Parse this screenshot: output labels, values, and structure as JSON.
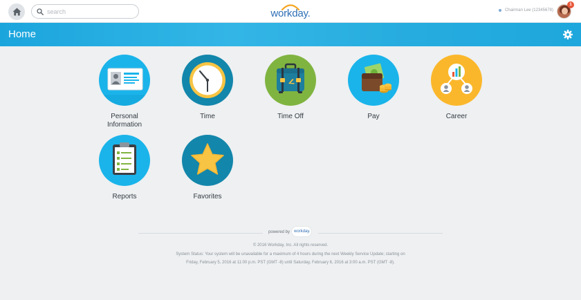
{
  "topbar": {
    "search_placeholder": "search",
    "logo": "workday.",
    "user_name": "Chairman Lee (12345678)",
    "notification_count": "1"
  },
  "header": {
    "title": "Home"
  },
  "worklets": [
    {
      "label": "Personal Information",
      "color": "#1ab4ea"
    },
    {
      "label": "Time",
      "color": "#1386ab"
    },
    {
      "label": "Time Off",
      "color": "#80b440"
    },
    {
      "label": "Pay",
      "color": "#1ab4ea"
    },
    {
      "label": "Career",
      "color": "#fbb72b"
    },
    {
      "label": "Reports",
      "color": "#1ab4ea"
    },
    {
      "label": "Favorites",
      "color": "#1386ab"
    }
  ],
  "footer": {
    "powered_by": "powered by",
    "logo": "workday.",
    "copyright": "© 2016 Workday, Inc. All rights reserved.",
    "status_line1": "System Status: Your system will be unavailable for a maximum of 4 hours during the next Weekly Service Update; starting on",
    "status_line2": "Friday, February 5, 2016 at 11:00 p.m. PST (GMT -8) until Saturday, February 6, 2016 at 3:00 a.m. PST (GMT -8)."
  }
}
